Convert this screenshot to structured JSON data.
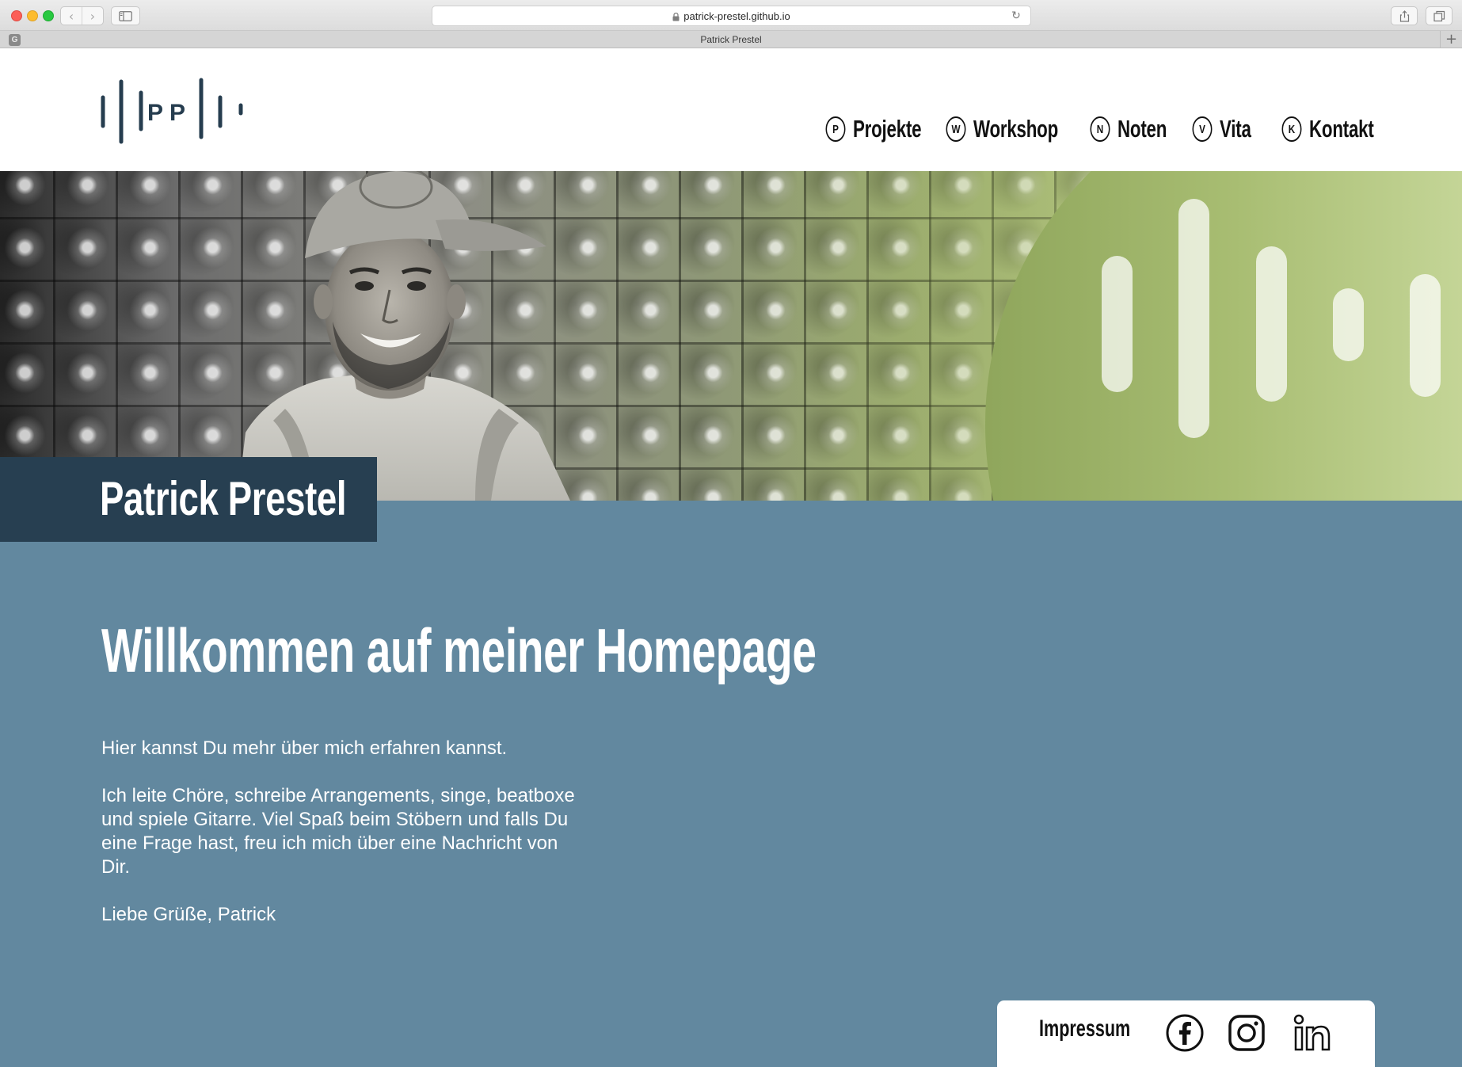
{
  "browser": {
    "url": "patrick-prestel.github.io",
    "tab_title": "Patrick Prestel",
    "tab_favicon_letter": "G",
    "back_glyph": "‹",
    "forward_glyph": "›",
    "reload_glyph": "↻",
    "new_tab_glyph": "+"
  },
  "header": {
    "logo_text": "PP",
    "nav": [
      {
        "badge": "P",
        "label": "Projekte"
      },
      {
        "badge": "W",
        "label": "Workshop"
      },
      {
        "badge": "N",
        "label": "Noten"
      },
      {
        "badge": "V",
        "label": "Vita"
      },
      {
        "badge": "K",
        "label": "Kontakt"
      }
    ]
  },
  "hero": {
    "name": "Patrick Prestel"
  },
  "main": {
    "headline": "Willkommen auf meiner Homepage",
    "paragraphs": [
      "Hier kannst Du mehr über mich erfahren kannst.",
      "Ich leite Chöre, schreibe Arrangements, singe, beatboxe und spiele Gitarre. Viel Spaß beim Stöbern und falls Du eine Frage hast, freu ich mich über eine Nachricht von Dir.",
      "Liebe Grüße, Patrick"
    ]
  },
  "footer": {
    "impressum_label": "Impressum",
    "social_icons": [
      "facebook-icon",
      "instagram-icon",
      "linkedin-icon"
    ]
  },
  "colors": {
    "dark_blue": "#273f51",
    "steel_blue": "#62889f",
    "olive_green": "#a8bd72",
    "text_dark": "#111111"
  }
}
